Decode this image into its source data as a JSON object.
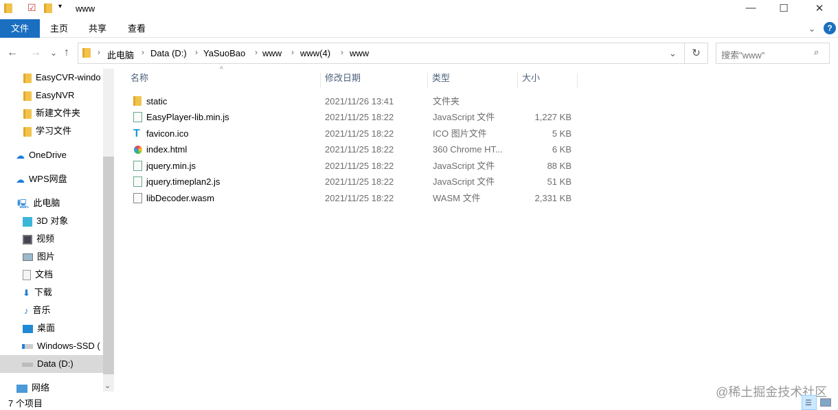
{
  "window": {
    "title": "www",
    "minimize": "—",
    "maximize": "☐",
    "close": "✕"
  },
  "ribbon": {
    "tabs": [
      "文件",
      "主页",
      "共享",
      "查看"
    ],
    "help": "?",
    "expand": "⌄"
  },
  "nav": {
    "back": "←",
    "forward": "→",
    "recent": "⌄",
    "up": "↑",
    "refresh": "↻",
    "dropdown": "⌄"
  },
  "address": {
    "crumbs": [
      "此电脑",
      "Data (D:)",
      "YaSuoBao",
      "www",
      "www(4)",
      "www"
    ]
  },
  "search": {
    "placeholder": "搜索\"www\""
  },
  "sidebar": {
    "items": [
      {
        "label": "EasyCVR-windo",
        "icon": "folder-icon"
      },
      {
        "label": "EasyNVR",
        "icon": "folder-icon"
      },
      {
        "label": "新建文件夹",
        "icon": "folder-icon"
      },
      {
        "label": "学习文件",
        "icon": "folder-icon"
      },
      {
        "label": "OneDrive",
        "icon": "cloud-icon"
      },
      {
        "label": "WPS网盘",
        "icon": "cloud-icon"
      },
      {
        "label": "此电脑",
        "icon": "computer-icon"
      },
      {
        "label": "3D 对象",
        "icon": "cube-icon"
      },
      {
        "label": "视频",
        "icon": "video-icon"
      },
      {
        "label": "图片",
        "icon": "picture-icon"
      },
      {
        "label": "文档",
        "icon": "document-icon"
      },
      {
        "label": "下载",
        "icon": "download-icon"
      },
      {
        "label": "音乐",
        "icon": "music-icon"
      },
      {
        "label": "桌面",
        "icon": "desktop-icon"
      },
      {
        "label": "Windows-SSD (",
        "icon": "drive-icon"
      },
      {
        "label": "Data (D:)",
        "icon": "drive-icon"
      },
      {
        "label": "网络",
        "icon": "network-icon"
      }
    ]
  },
  "columns": {
    "name": "名称",
    "date": "修改日期",
    "type": "类型",
    "size": "大小"
  },
  "files": [
    {
      "name": "static",
      "date": "2021/11/26 13:41",
      "type": "文件夹",
      "size": "",
      "icon": "folder-icon"
    },
    {
      "name": "EasyPlayer-lib.min.js",
      "date": "2021/11/25 18:22",
      "type": "JavaScript 文件",
      "size": "1,227 KB",
      "icon": "js-file-icon"
    },
    {
      "name": "favicon.ico",
      "date": "2021/11/25 18:22",
      "type": "ICO 图片文件",
      "size": "5 KB",
      "icon": "ico-file-icon"
    },
    {
      "name": "index.html",
      "date": "2021/11/25 18:22",
      "type": "360 Chrome HT...",
      "size": "6 KB",
      "icon": "html-file-icon"
    },
    {
      "name": "jquery.min.js",
      "date": "2021/11/25 18:22",
      "type": "JavaScript 文件",
      "size": "88 KB",
      "icon": "js-file-icon"
    },
    {
      "name": "jquery.timeplan2.js",
      "date": "2021/11/25 18:22",
      "type": "JavaScript 文件",
      "size": "51 KB",
      "icon": "js-file-icon"
    },
    {
      "name": "libDecoder.wasm",
      "date": "2021/11/25 18:22",
      "type": "WASM 文件",
      "size": "2,331 KB",
      "icon": "file-icon"
    }
  ],
  "status": {
    "count": "7 个项目"
  },
  "watermark": "@稀土掘金技术社区",
  "colors": {
    "accent": "#1a6fc0",
    "folder": "#f2c34c"
  }
}
